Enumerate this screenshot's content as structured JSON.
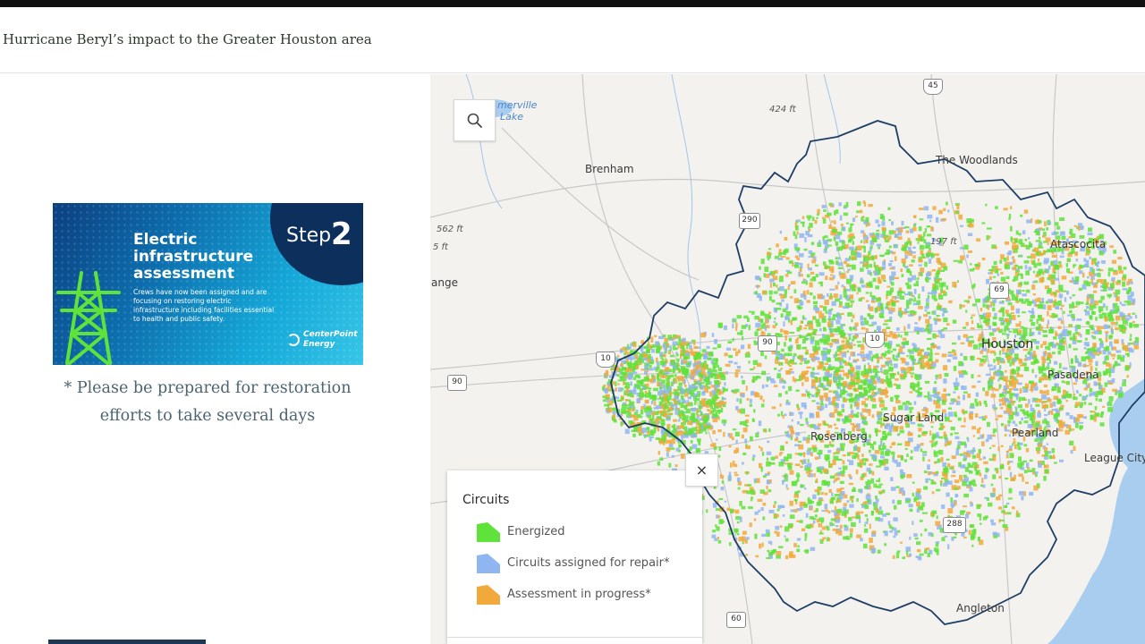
{
  "header": {
    "title": "Hurricane Beryl’s impact to the Greater Houston area"
  },
  "step_card": {
    "step_word": "Step",
    "step_number": "2",
    "title": "Electric infrastructure assessment",
    "body": "Crews have now been assigned and are focusing on restoring electric infrastructure including facilities essential to health and public safety.",
    "logo_text": "CenterPoint Energy"
  },
  "note": {
    "text": "* Please be prepared for restoration efforts to take several days"
  },
  "map": {
    "places": {
      "somerville": "merville",
      "lake": "Lake",
      "brenham": "Brenham",
      "woodlands": "The Woodlands",
      "atascocita": "Atascocita",
      "houston": "Houston",
      "pasadena": "Pasadena",
      "sugar_land": "Sugar Land",
      "rosenberg": "Rosenberg",
      "pearland": "Pearland",
      "league_city": "League City",
      "angleton": "Angleton",
      "grange": "ange"
    },
    "elevations": {
      "e1": "424 ft",
      "e2": "562 ft",
      "e3": "5 ft",
      "e4": "197 ft"
    },
    "shields": {
      "i45": "45",
      "r290": "290",
      "r69": "69",
      "i10a": "10",
      "r90a": "90",
      "i10b": "10",
      "r90b": "90",
      "r288": "288",
      "r60": "60"
    }
  },
  "legend": {
    "title": "Circuits",
    "items": [
      {
        "label": "Energized",
        "color": "#5fe33a"
      },
      {
        "label": "Circuits assigned for repair*",
        "color": "#8fb6f0"
      },
      {
        "label": "Assessment in progress*",
        "color": "#f2a93b"
      }
    ]
  },
  "controls": {
    "close_glyph": "×"
  },
  "colors": {
    "energized": "#5fe33a",
    "repair": "#8fb6f0",
    "assessment": "#f2a93b",
    "boundary": "#1f3e66",
    "water": "#a9cdee"
  }
}
